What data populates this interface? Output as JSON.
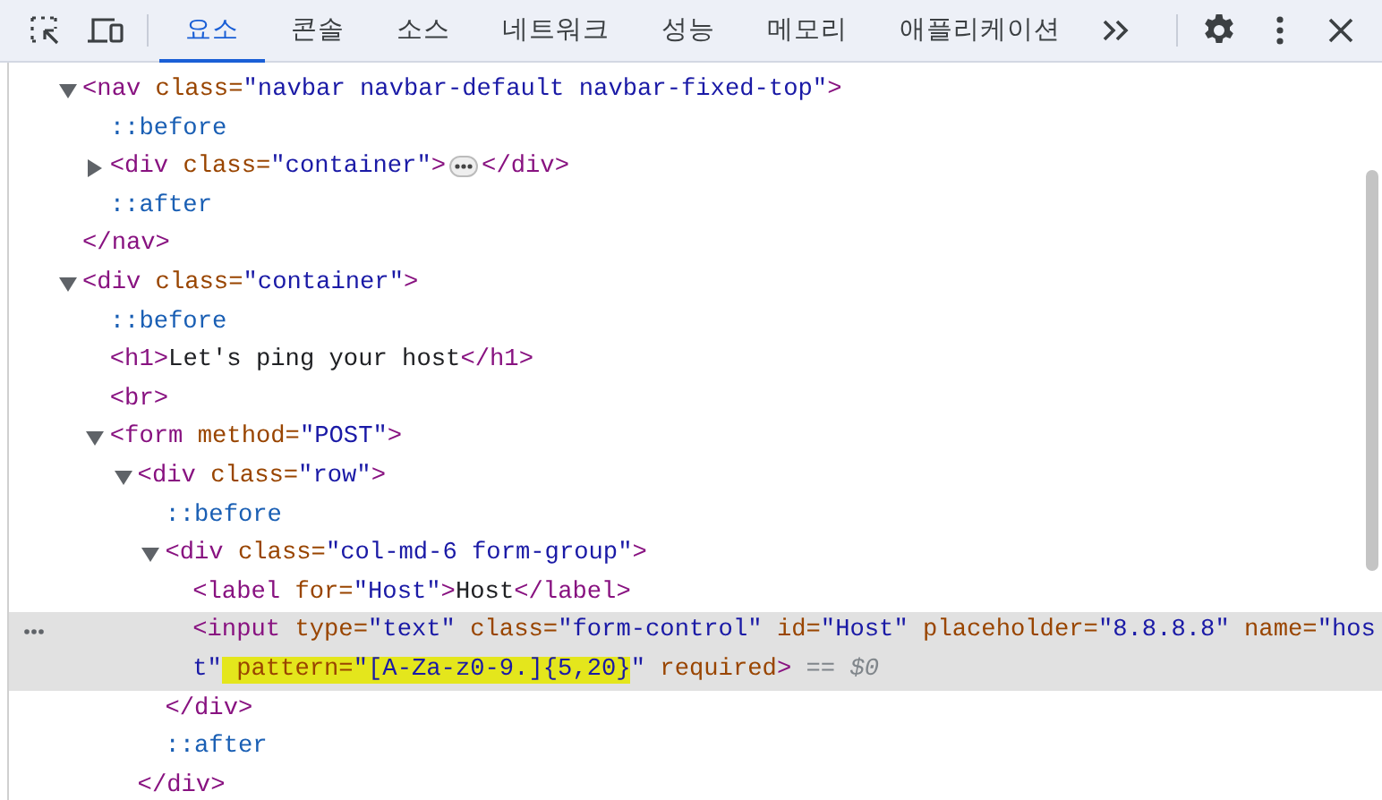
{
  "toolbar": {
    "tabs": [
      {
        "label": "요소",
        "selected": true
      },
      {
        "label": "콘솔",
        "selected": false
      },
      {
        "label": "소스",
        "selected": false
      },
      {
        "label": "네트워크",
        "selected": false
      },
      {
        "label": "성능",
        "selected": false
      },
      {
        "label": "메모리",
        "selected": false
      },
      {
        "label": "애플리케이션",
        "selected": false
      }
    ]
  },
  "dom_tree": [
    {
      "selected": false,
      "expanded": true,
      "parts": [
        {
          "kind": "tag",
          "text": "<nav"
        },
        {
          "kind": "attr",
          "text": " class="
        },
        {
          "kind": "value",
          "text": "\"navbar navbar-default navbar-fixed-top\""
        },
        {
          "kind": "tag",
          "text": ">"
        }
      ],
      "children": [
        {
          "selected": false,
          "parts": [
            {
              "kind": "pseudo",
              "text": "::before"
            }
          ]
        },
        {
          "selected": false,
          "expanded": false,
          "parts": [
            {
              "kind": "tag",
              "text": "<div"
            },
            {
              "kind": "attr",
              "text": " class="
            },
            {
              "kind": "value",
              "text": "\"container\""
            },
            {
              "kind": "tag",
              "text": ">"
            },
            {
              "kind": "ellipsis"
            },
            {
              "kind": "tag",
              "text": "</div>"
            }
          ]
        },
        {
          "selected": false,
          "parts": [
            {
              "kind": "pseudo",
              "text": "::after"
            }
          ]
        }
      ],
      "close": [
        {
          "kind": "tag",
          "text": "</nav>"
        }
      ]
    },
    {
      "selected": false,
      "expanded": true,
      "parts": [
        {
          "kind": "tag",
          "text": "<div"
        },
        {
          "kind": "attr",
          "text": " class="
        },
        {
          "kind": "value",
          "text": "\"container\""
        },
        {
          "kind": "tag",
          "text": ">"
        }
      ],
      "children": [
        {
          "selected": false,
          "parts": [
            {
              "kind": "pseudo",
              "text": "::before"
            }
          ]
        },
        {
          "selected": false,
          "parts": [
            {
              "kind": "tag",
              "text": "<h1>"
            },
            {
              "kind": "text",
              "text": "Let's ping your host"
            },
            {
              "kind": "tag",
              "text": "</h1>"
            }
          ]
        },
        {
          "selected": false,
          "parts": [
            {
              "kind": "tag",
              "text": "<br>"
            }
          ]
        },
        {
          "selected": false,
          "expanded": true,
          "parts": [
            {
              "kind": "tag",
              "text": "<form"
            },
            {
              "kind": "attr",
              "text": " method="
            },
            {
              "kind": "value",
              "text": "\"POST\""
            },
            {
              "kind": "tag",
              "text": ">"
            }
          ],
          "children": [
            {
              "selected": false,
              "expanded": true,
              "parts": [
                {
                  "kind": "tag",
                  "text": "<div"
                },
                {
                  "kind": "attr",
                  "text": " class="
                },
                {
                  "kind": "value",
                  "text": "\"row\""
                },
                {
                  "kind": "tag",
                  "text": ">"
                }
              ],
              "children": [
                {
                  "selected": false,
                  "parts": [
                    {
                      "kind": "pseudo",
                      "text": "::before"
                    }
                  ]
                },
                {
                  "selected": false,
                  "expanded": true,
                  "parts": [
                    {
                      "kind": "tag",
                      "text": "<div"
                    },
                    {
                      "kind": "attr",
                      "text": " class="
                    },
                    {
                      "kind": "value",
                      "text": "\"col-md-6 form-group\""
                    },
                    {
                      "kind": "tag",
                      "text": ">"
                    }
                  ],
                  "children": [
                    {
                      "selected": false,
                      "parts": [
                        {
                          "kind": "tag",
                          "text": "<label"
                        },
                        {
                          "kind": "attr",
                          "text": " for="
                        },
                        {
                          "kind": "value",
                          "text": "\"Host\""
                        },
                        {
                          "kind": "tag",
                          "text": ">"
                        },
                        {
                          "kind": "text",
                          "text": "Host"
                        },
                        {
                          "kind": "tag",
                          "text": "</label>"
                        }
                      ]
                    },
                    {
                      "selected": true,
                      "parts": [
                        {
                          "kind": "tag",
                          "text": "<input"
                        },
                        {
                          "kind": "attr",
                          "text": " type="
                        },
                        {
                          "kind": "value",
                          "text": "\"text\""
                        },
                        {
                          "kind": "attr",
                          "text": " class="
                        },
                        {
                          "kind": "value",
                          "text": "\"form-control\""
                        },
                        {
                          "kind": "attr",
                          "text": " id="
                        },
                        {
                          "kind": "value",
                          "text": "\"Host\""
                        },
                        {
                          "kind": "attr",
                          "text": " placeholder="
                        },
                        {
                          "kind": "value",
                          "text": "\"8.8.8.8\""
                        },
                        {
                          "kind": "attr",
                          "text": " name="
                        },
                        {
                          "kind": "value",
                          "text": "\"host\""
                        },
                        {
                          "kind": "attr",
                          "text": " pattern=",
                          "highlight": true
                        },
                        {
                          "kind": "value",
                          "text": "\"[A-Za-z0-9.]{5,20}",
                          "highlight": true
                        },
                        {
                          "kind": "value",
                          "text": "\""
                        },
                        {
                          "kind": "attr",
                          "text": " required"
                        },
                        {
                          "kind": "tag",
                          "text": ">"
                        },
                        {
                          "kind": "ref",
                          "text": " == $0"
                        }
                      ]
                    }
                  ],
                  "close": [
                    {
                      "kind": "tag",
                      "text": "</div>"
                    }
                  ]
                },
                {
                  "selected": false,
                  "parts": [
                    {
                      "kind": "pseudo",
                      "text": "::after"
                    }
                  ]
                }
              ],
              "close": [
                {
                  "kind": "tag",
                  "text": "</div>"
                }
              ]
            }
          ]
        }
      ]
    }
  ]
}
